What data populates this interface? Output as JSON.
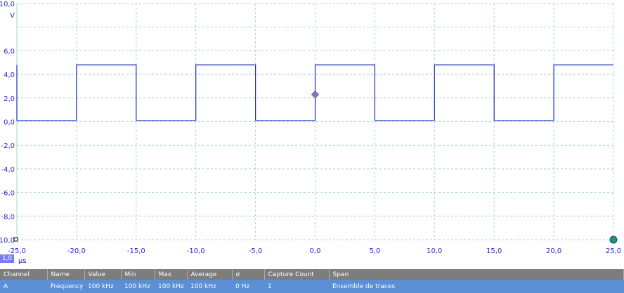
{
  "chart_data": {
    "type": "line",
    "xunit": "µs",
    "yunit": "V",
    "xlim": [
      -25,
      25
    ],
    "ylim": [
      -10,
      10
    ],
    "xticks": [
      -25,
      -20,
      -15,
      -10,
      -5,
      0,
      5,
      10,
      15,
      20,
      25
    ],
    "xtick_labels": [
      "-25,0",
      "-20,0",
      "-15,0",
      "-10,0",
      "-5,0",
      "0,0",
      "5,0",
      "10,0",
      "15,0",
      "20,0",
      "25,0"
    ],
    "yticks": [
      10,
      6,
      4,
      2,
      0,
      -2,
      -4,
      -6,
      -8,
      -10
    ],
    "ytick_labels": [
      "10,0",
      "6,0",
      "4,0",
      "2,0",
      "0,0",
      "-2,0",
      "-4,0",
      "-6,0",
      "-8,0",
      "-10,0"
    ],
    "grid": true,
    "series": [
      {
        "color": "#1c2fbf",
        "x": [
          -25,
          -25,
          -20,
          -20,
          -15,
          -15,
          -10,
          -10,
          -5,
          -5,
          0,
          0,
          5,
          5,
          10,
          10,
          15,
          15,
          20,
          20,
          25
        ],
        "y": [
          4.8,
          0.1,
          0.1,
          4.8,
          4.8,
          0.1,
          0.1,
          4.8,
          4.8,
          0.1,
          0.1,
          4.8,
          4.8,
          0.1,
          0.1,
          4.8,
          4.8,
          0.1,
          0.1,
          4.8,
          4.8
        ]
      }
    ],
    "trigger": {
      "x": 0,
      "y": 2.3,
      "color": "#7f7fb8"
    },
    "marker_end": {
      "x": 25,
      "y": -10,
      "color": "#1f8f86"
    },
    "grid_color": "#a8d3e0",
    "axis_color": "#2b2bd0"
  },
  "scope": {
    "marker_label": "1,0"
  },
  "measurements": {
    "headers": [
      "Channel",
      "Name",
      "Value",
      "Min",
      "Max",
      "Average",
      "σ",
      "Capture Count",
      "Span"
    ],
    "rows": [
      [
        "A",
        "Frequency",
        "100 kHz",
        "100 kHz",
        "100 kHz",
        "100 kHz",
        "0 Hz",
        "1",
        "Ensemble de traces"
      ]
    ]
  }
}
